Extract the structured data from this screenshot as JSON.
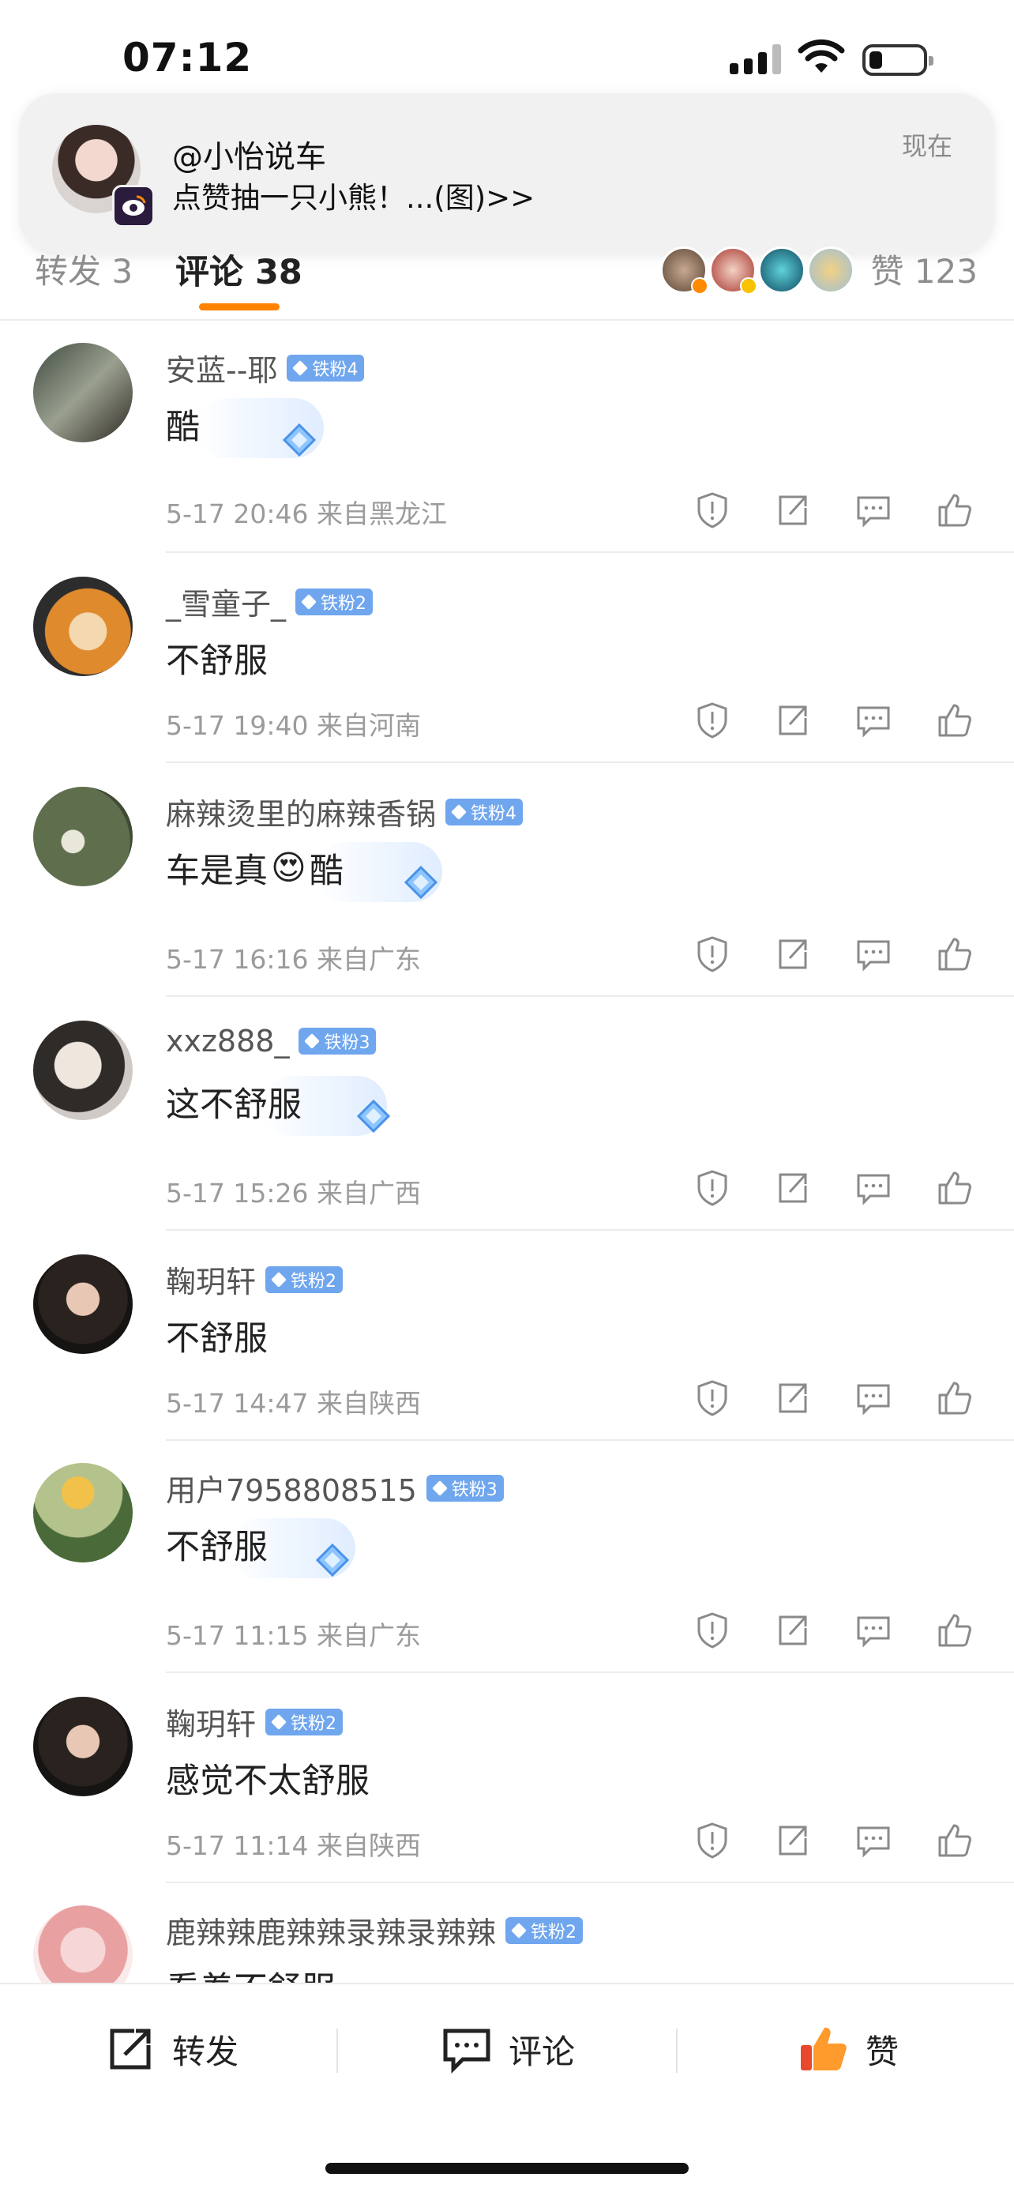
{
  "status_bar": {
    "time": "07:12"
  },
  "notification": {
    "title": "@小怡说车",
    "body": "点赞抽一只小熊！...(图)>>",
    "time": "现在"
  },
  "tabs": {
    "repost": "转发 3",
    "comments": "评论 38",
    "likes": "赞 123"
  },
  "comments": [
    {
      "user": "安蓝--耶",
      "badge": "铁粉4",
      "text": "酷",
      "meta": "5-17 20:46  来自黑龙江"
    },
    {
      "user": "_雪童子_",
      "badge": "铁粉2",
      "text": "不舒服",
      "meta": "5-17 19:40  来自河南"
    },
    {
      "user": "麻辣烫里的麻辣香锅",
      "badge": "铁粉4",
      "text_before": "车是真",
      "emoji": "😍",
      "text_after": "酷",
      "meta": "5-17 16:16  来自广东"
    },
    {
      "user": "xxz888_",
      "badge": "铁粉3",
      "text": "这不舒服",
      "meta": "5-17 15:26  来自广西"
    },
    {
      "user": "鞠玥轩",
      "badge": "铁粉2",
      "text": "不舒服",
      "meta": "5-17 14:47  来自陕西"
    },
    {
      "user": "用户7958808515",
      "badge": "铁粉3",
      "text": "不舒服",
      "meta": "5-17 11:15  来自广东"
    },
    {
      "user": "鞠玥轩",
      "badge": "铁粉2",
      "text": "感觉不太舒服",
      "meta": "5-17 11:14  来自陕西"
    },
    {
      "user": "鹿辣辣鹿辣辣录辣录辣辣",
      "badge": "铁粉2",
      "text": "看着不舒服"
    }
  ],
  "bottom_bar": {
    "repost": "转发",
    "comment": "评论",
    "like": "赞"
  },
  "colors": {
    "accent": "#ff8200",
    "fan_badge": "#6fa6ee",
    "meta_text": "#9b9b9b"
  }
}
